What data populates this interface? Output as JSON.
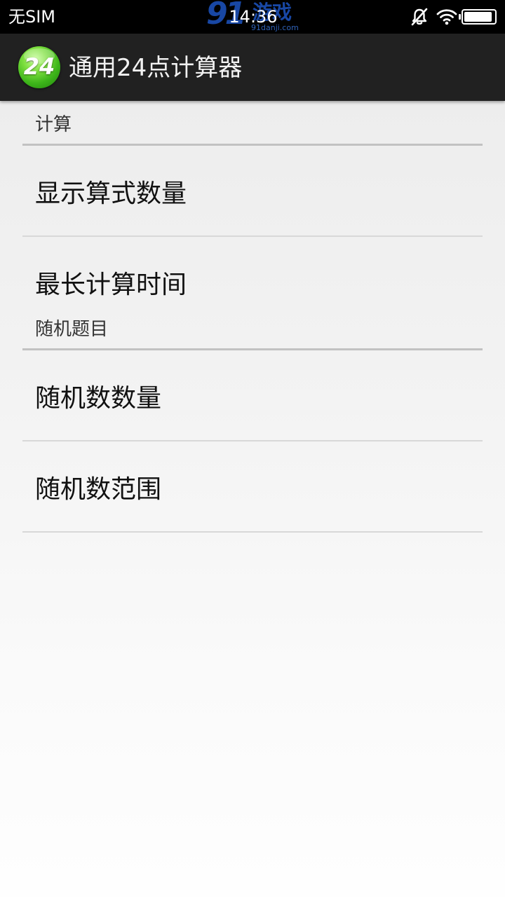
{
  "status_bar": {
    "carrier": "无SIM",
    "time": "14:36",
    "watermark": {
      "number": "91",
      "text": "游戏",
      "url": "91danji.com"
    },
    "icons": [
      "bell-muted-icon",
      "wifi-icon",
      "battery-icon"
    ],
    "battery_level": 0.92
  },
  "app_bar": {
    "icon_text": "24",
    "title": "通用24点计算器"
  },
  "preferences": {
    "categories": [
      {
        "label": "计算",
        "items": [
          {
            "label": "显示算式数量"
          },
          {
            "label": "最长计算时间"
          }
        ]
      },
      {
        "label": "随机题目",
        "items": [
          {
            "label": "随机数数量"
          },
          {
            "label": "随机数范围"
          }
        ]
      }
    ]
  },
  "colors": {
    "status_bar_bg": "#000000",
    "app_bar_bg": "#212121",
    "icon_green": "#3db51a",
    "category_line": "#c2c2c2",
    "divider": "#d8d8d8"
  }
}
